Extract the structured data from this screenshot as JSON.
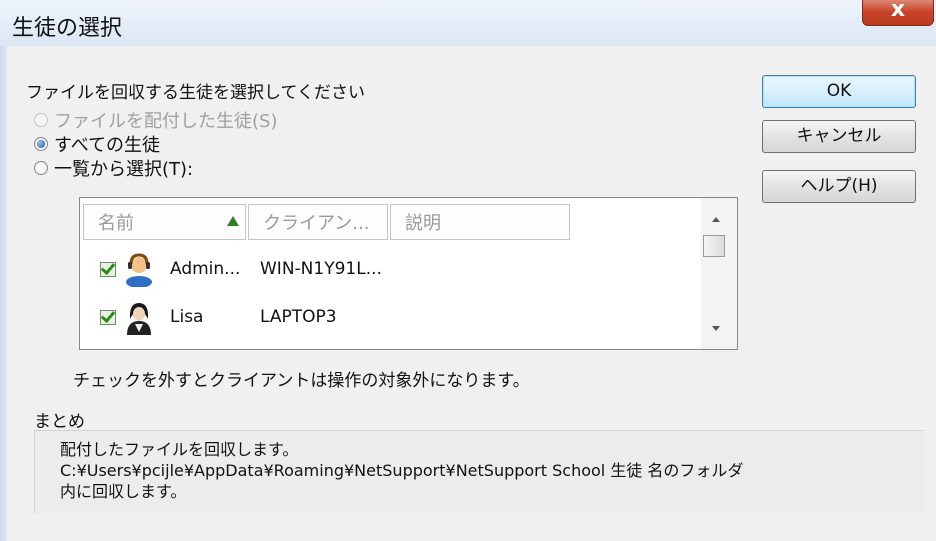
{
  "window": {
    "title": "生徒の選択",
    "close_label": "x"
  },
  "dialog": {
    "prompt": "ファイルを回収する生徒を選択してください"
  },
  "buttons": {
    "ok": "OK",
    "cancel": "キャンセル",
    "help": "ヘルプ(H)"
  },
  "radios": [
    {
      "label": "ファイルを配付した生徒(S)",
      "state": "disabled"
    },
    {
      "label": "すべての生徒",
      "state": "selected"
    },
    {
      "label": "一覧から選択(T):",
      "state": "unselected"
    }
  ],
  "student_list": {
    "columns": [
      "名前",
      "クライアン...",
      "説明"
    ],
    "sort_column": "名前",
    "rows": [
      {
        "name": "Admin...",
        "client": "WIN-N1Y91L...",
        "description": "",
        "checked": true,
        "avatar": "headset-user-icon"
      },
      {
        "name": "Lisa",
        "client": "LAPTOP3",
        "description": "",
        "checked": true,
        "avatar": "female-student-icon"
      }
    ]
  },
  "note": "チェックを外すとクライアントは操作の対象外になります。",
  "summary": {
    "title": "まとめ",
    "line1": "配付したファイルを回収します。",
    "line2": "C:¥Users¥pcijle¥AppData¥Roaming¥NetSupport¥NetSupport School 生徒 名のフォルダ",
    "line3": "内に回収します。"
  },
  "colors": {
    "close_button": "#c9442a",
    "default_button_border": "#3c7fb1",
    "sort_arrow": "#2f7d2a",
    "check_mark": "#2a8a1a"
  }
}
